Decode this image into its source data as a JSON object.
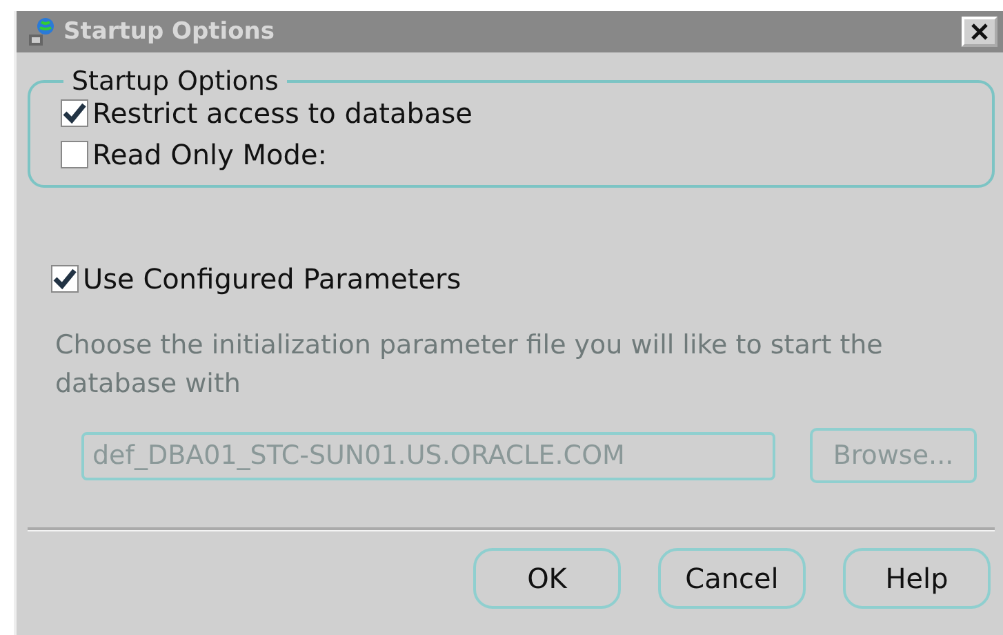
{
  "window": {
    "title": "Startup Options"
  },
  "startup_options": {
    "title": "Startup Options",
    "checkboxes": [
      {
        "label": "Restrict access to database",
        "checked": true
      },
      {
        "label": "Read Only Mode:",
        "checked": false
      }
    ]
  },
  "use_configured": {
    "label": "Use Configured Parameters",
    "checked": true
  },
  "parameter_file": {
    "description": "Choose the initialization parameter file you will like to start the database with",
    "value": "def_DBA01_STC-SUN01.US.ORACLE.COM",
    "browse": "Browse...",
    "disabled": true
  },
  "buttons": [
    "OK",
    "Cancel",
    "Help"
  ]
}
